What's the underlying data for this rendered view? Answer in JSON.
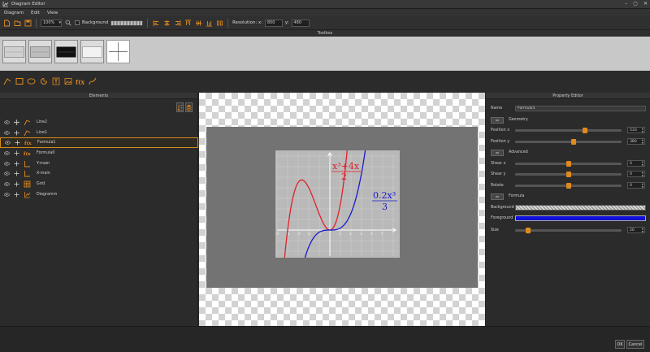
{
  "window": {
    "title": "Diagram Editor",
    "controls": [
      "–",
      "▢",
      "✕"
    ]
  },
  "menu": [
    "Diagram",
    "Edit",
    "View"
  ],
  "toolbar": {
    "zoom": "100%",
    "background_label": "Background",
    "resolution_label": "Resolution: x:",
    "res_x": "800",
    "res_y_label": "y:",
    "res_y": "480"
  },
  "toolbox": {
    "title": "Toolbox"
  },
  "elements": {
    "title": "Elements",
    "items": [
      {
        "name": "Line2",
        "type": "line",
        "selected": false
      },
      {
        "name": "Line1",
        "type": "line",
        "selected": false
      },
      {
        "name": "Formula1",
        "type": "formula",
        "selected": true
      },
      {
        "name": "Formula0",
        "type": "formula",
        "selected": false
      },
      {
        "name": "Y-main",
        "type": "axis",
        "selected": false
      },
      {
        "name": "X-main",
        "type": "axis",
        "selected": false
      },
      {
        "name": "Grid",
        "type": "grid",
        "selected": false
      },
      {
        "name": "Diagramm",
        "type": "diagram",
        "selected": false
      }
    ]
  },
  "diagram": {
    "formula_red": {
      "top": "x³+4x",
      "bottom": "2",
      "color": "#e0202a"
    },
    "formula_blue": {
      "top": "0.2x³",
      "bottom": "3",
      "color": "#1a1acc"
    },
    "x_ticks": [
      "-5",
      "-4",
      "-3",
      "-2",
      "-1",
      "1",
      "2",
      "3",
      "4",
      "5"
    ]
  },
  "props": {
    "title": "Property Editor",
    "name_label": "Name",
    "name_value": "Formula1",
    "geometry_label": "Geometry",
    "posx_label": "Position x",
    "posx_value": "533",
    "posx_frac": 0.66,
    "posy_label": "Position y",
    "posy_value": "380",
    "posy_frac": 0.55,
    "advanced_label": "Advanced",
    "shearx_label": "Shear x",
    "shearx_value": "0",
    "shearx_frac": 0.5,
    "sheary_label": "Shear y",
    "sheary_value": "0",
    "sheary_frac": 0.5,
    "rotate_label": "Rotate",
    "rotate_value": "0",
    "rotate_frac": 0.5,
    "formula_label": "Formula",
    "bg_label": "Background",
    "fg_label": "Foreground",
    "fg_color": "#1010d8",
    "size_label": "Size",
    "size_value": "20",
    "size_frac": 0.1
  },
  "footer": {
    "ok": "OK",
    "cancel": "Cancel"
  },
  "colors": {
    "accent": "#e08a1e"
  }
}
